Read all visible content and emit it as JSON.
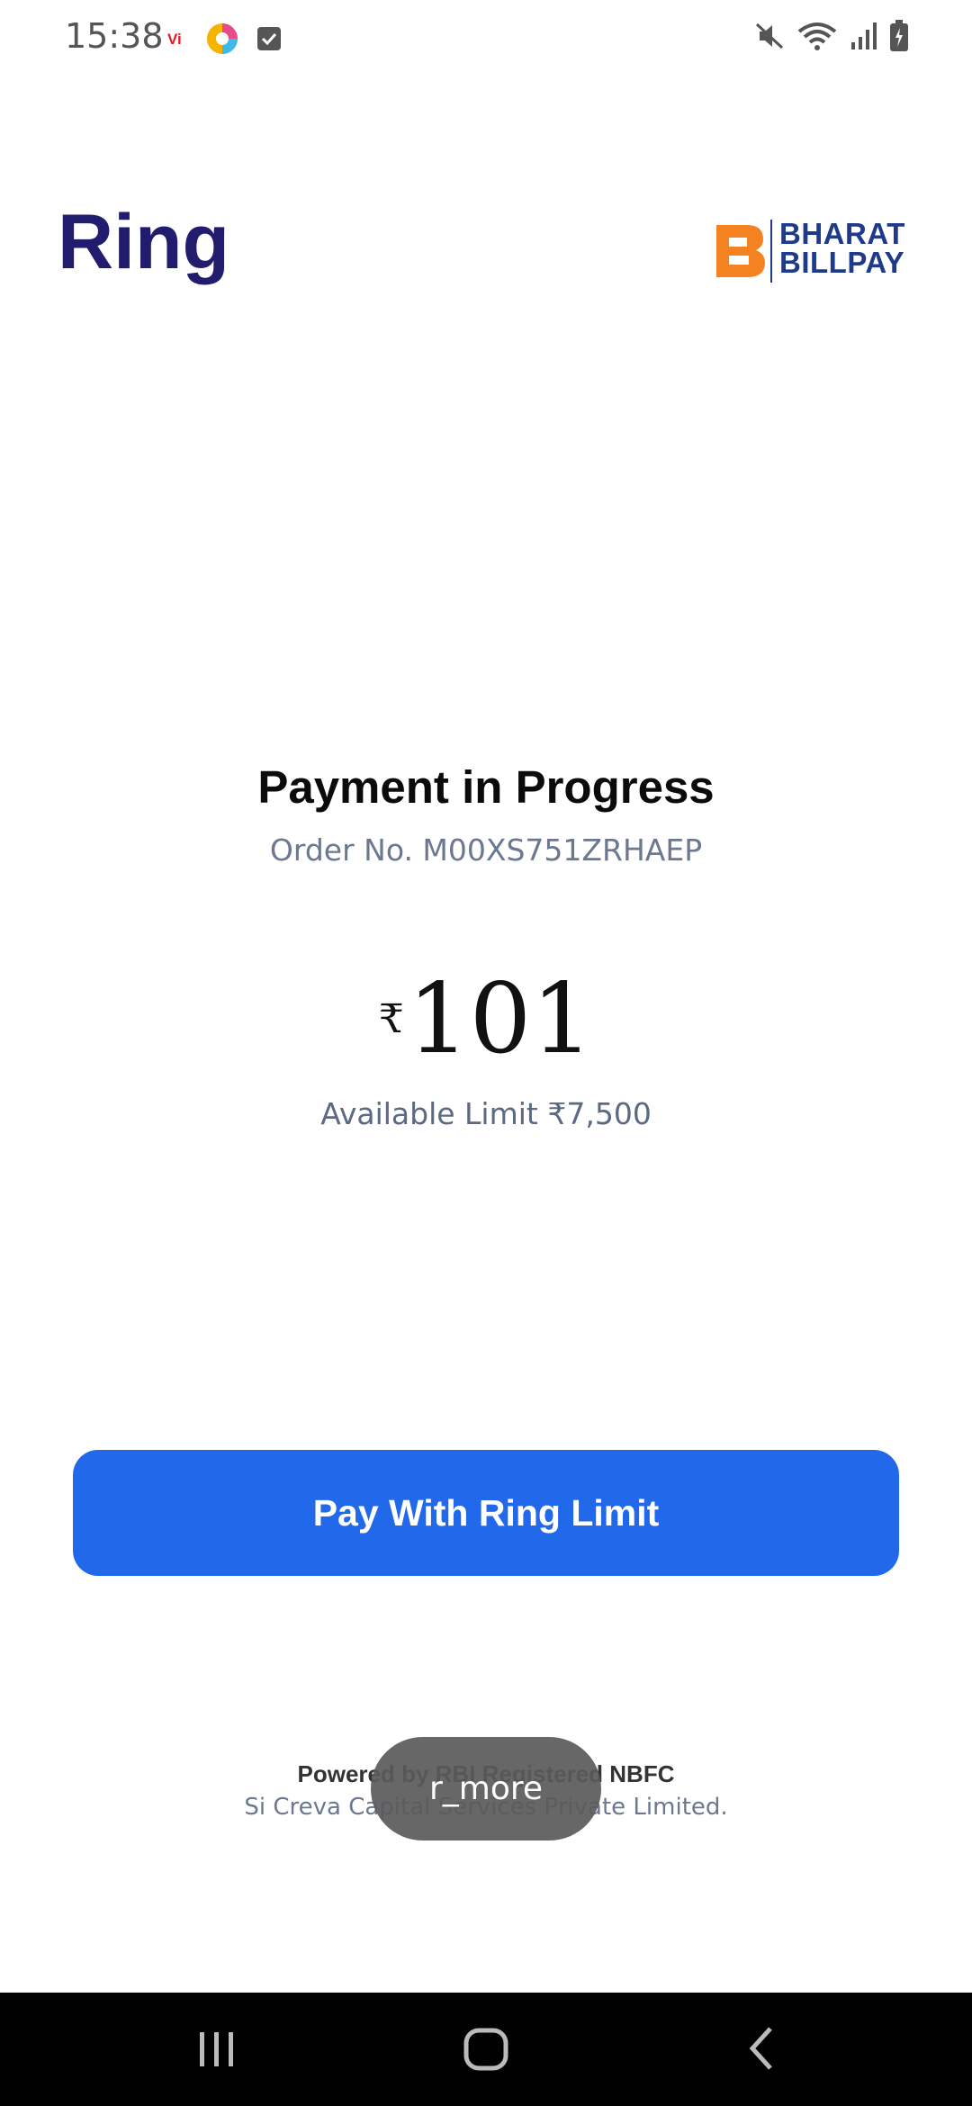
{
  "status_bar": {
    "time": "15:38",
    "left_icons": [
      "vi-icon",
      "browser-icon",
      "checkbox-notification-icon"
    ],
    "right_icons": [
      "mute-icon",
      "wifi-icon",
      "signal-icon",
      "battery-icon"
    ]
  },
  "header": {
    "app_logo": "Ring",
    "partner_logo_line1": "BHARAT",
    "partner_logo_line2": "BILLPAY"
  },
  "payment": {
    "title": "Payment in Progress",
    "order_number": "Order No. M00XS751ZRHAEP",
    "currency_symbol": "₹",
    "amount": "101",
    "available_limit": "Available Limit ₹7,500"
  },
  "actions": {
    "pay_label": "Pay With Ring Limit"
  },
  "footer": {
    "powered_by": "Powered by RBI Registered NBFC",
    "company": "Si Creva Capital Services Private Limited."
  },
  "toast": {
    "text": "r_more"
  },
  "colors": {
    "primary_button": "#2268ea",
    "ring_brand": "#221c6e",
    "bbps_orange": "#f58220",
    "bbps_blue": "#1f3a8a"
  }
}
